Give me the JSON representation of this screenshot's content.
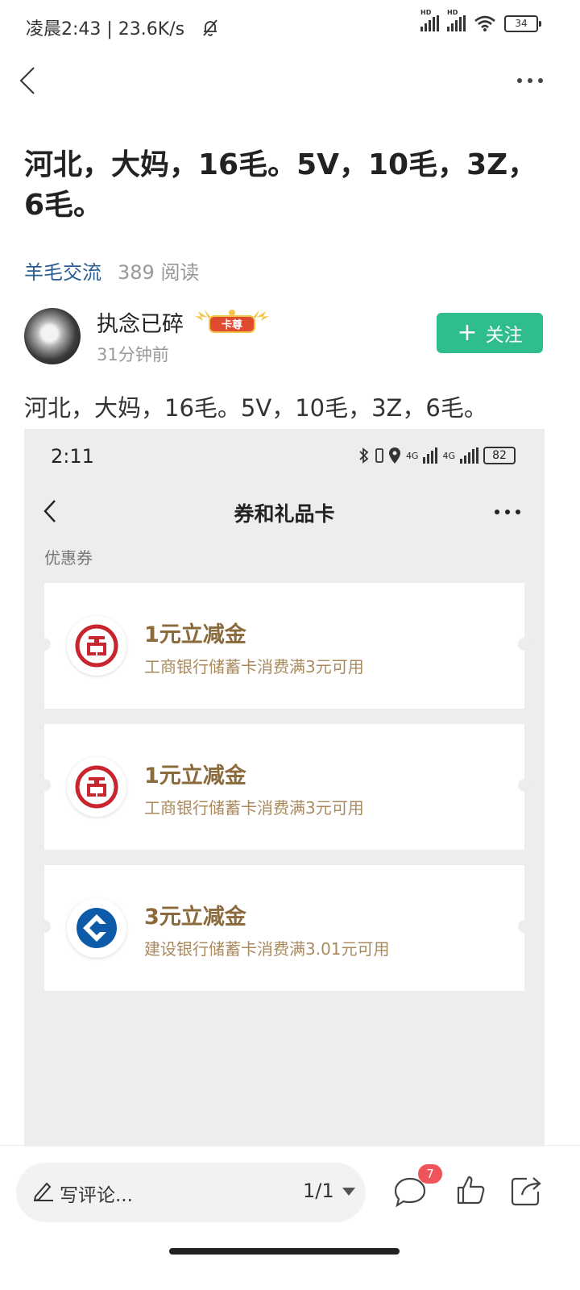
{
  "status_bar": {
    "time_speed": "凌晨2:43 | 23.6K/s",
    "signal1": "HD",
    "signal2": "HD",
    "battery": "34"
  },
  "post": {
    "title": "河北，大妈，16毛。5V，10毛，3Z，6毛。",
    "tag": "羊毛交流",
    "reads": "389 阅读",
    "author": {
      "name": "执念已碎",
      "badge_text": "卡尊",
      "time_ago": "31分钟前"
    },
    "follow_label": "关注",
    "body": "河北，大妈，16毛。5V，10毛，3Z，6毛。"
  },
  "embedded": {
    "time": "2:11",
    "net1": "4G",
    "net2": "4G",
    "battery": "82",
    "page_title": "券和礼品卡",
    "section_label": "优惠券",
    "coupons": [
      {
        "title": "1元立减金",
        "desc": "工商银行储蓄卡消费满3元可用",
        "bank_icon": "icbc-logo-icon"
      },
      {
        "title": "1元立减金",
        "desc": "工商银行储蓄卡消费满3元可用",
        "bank_icon": "icbc-logo-icon"
      },
      {
        "title": "3元立减金",
        "desc": "建设银行储蓄卡消费满3.01元可用",
        "bank_icon": "ccb-logo-icon"
      }
    ]
  },
  "bottom_bar": {
    "comment_placeholder": "写评论...",
    "page_indicator": "1/1",
    "comment_count": "7"
  },
  "colors": {
    "accent_green": "#2fbd8f",
    "tag_blue": "#2b5f91",
    "coupon_gold": "#8b6a3b",
    "badge_red": "#f0545a"
  }
}
